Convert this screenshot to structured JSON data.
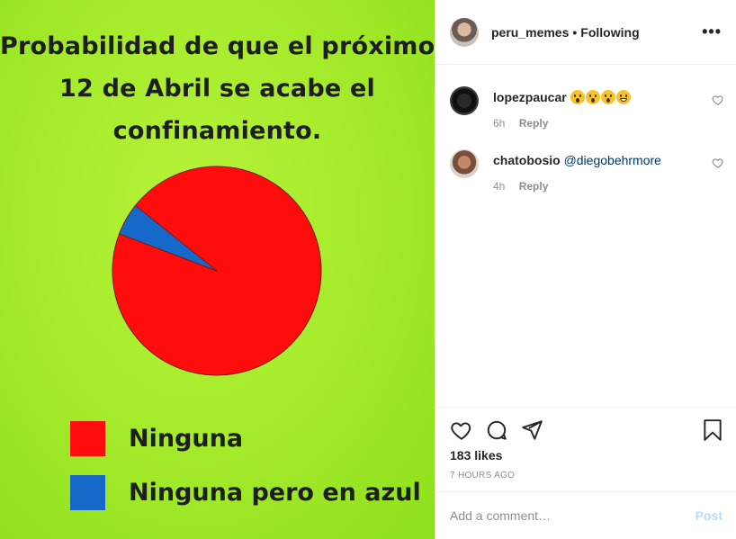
{
  "meme": {
    "title_lines": [
      "Probabilidad de que el próximo",
      "12 de Abril se acabe el",
      "confinamiento."
    ],
    "background_color": "#a6ec2c",
    "chart_data": {
      "type": "pie",
      "title": "Probabilidad de que el próximo 12 de Abril se acabe el confinamiento.",
      "categories": [
        "Ninguna",
        "Ninguna pero en azul"
      ],
      "values": [
        95,
        5
      ],
      "colors": [
        "#ff0d0d",
        "#1669c9"
      ],
      "legend_position": "bottom-left"
    }
  },
  "header": {
    "username": "peru_memes",
    "separator": "•",
    "follow_status": "Following",
    "more_icon": "more-options-icon"
  },
  "comments": [
    {
      "username": "lopezpaucar",
      "text": "",
      "emojis": [
        "astonished-face",
        "astonished-face",
        "astonished-face",
        "grinning-face"
      ],
      "time": "6h",
      "reply": "Reply"
    },
    {
      "username": "chatobosio",
      "text": "@diegobehrmore",
      "emojis": [],
      "time": "4h",
      "reply": "Reply"
    }
  ],
  "actions": {
    "like_icon": "heart-icon",
    "comment_icon": "comment-icon",
    "share_icon": "share-icon",
    "save_icon": "bookmark-icon"
  },
  "likes": "183 likes",
  "timestamp": "7 HOURS AGO",
  "add_comment": {
    "placeholder": "Add a comment…",
    "post_label": "Post"
  },
  "colors": {
    "text": "#262626",
    "muted": "#8e8e8e",
    "mention": "#00376b",
    "post_disabled": "#b2dffc"
  }
}
